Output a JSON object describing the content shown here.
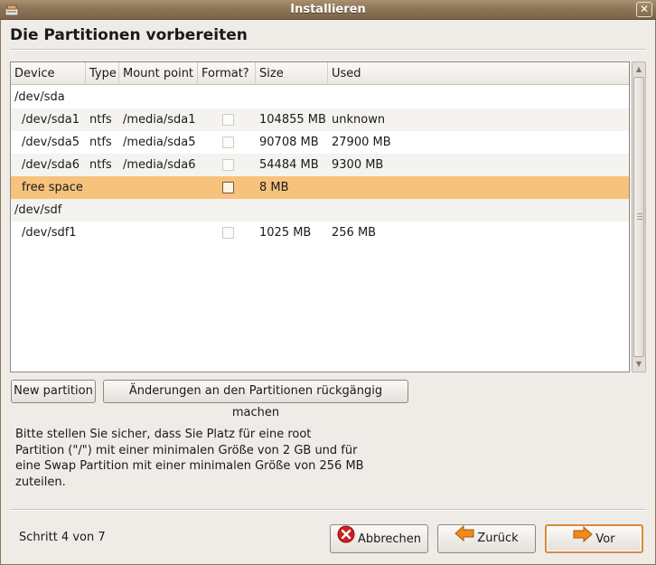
{
  "window": {
    "title": "Installieren"
  },
  "page": {
    "title": "Die Partitionen vorbereiten"
  },
  "table": {
    "headers": [
      "Device",
      "Type",
      "Mount point",
      "Format?",
      "Size",
      "Used"
    ],
    "rows": [
      {
        "device": "/dev/sda",
        "type": "",
        "mount": "",
        "format": null,
        "size": "",
        "used": ""
      },
      {
        "device": "/dev/sda1",
        "type": "ntfs",
        "mount": "/media/sda1",
        "format": false,
        "size": "104855 MB",
        "used": "unknown"
      },
      {
        "device": "/dev/sda5",
        "type": "ntfs",
        "mount": "/media/sda5",
        "format": false,
        "size": "90708 MB",
        "used": "27900 MB"
      },
      {
        "device": "/dev/sda6",
        "type": "ntfs",
        "mount": "/media/sda6",
        "format": false,
        "size": "54484 MB",
        "used": "9300 MB"
      },
      {
        "device": "free space",
        "type": "",
        "mount": "",
        "format": false,
        "size": "8 MB",
        "used": "",
        "selected": true
      },
      {
        "device": "/dev/sdf",
        "type": "",
        "mount": "",
        "format": null,
        "size": "",
        "used": ""
      },
      {
        "device": "/dev/sdf1",
        "type": "",
        "mount": "",
        "format": false,
        "size": "1025 MB",
        "used": "256 MB"
      }
    ]
  },
  "buttons": {
    "new_partition": "New partition",
    "undo_changes": "Änderungen an den Partitionen rückgängig machen",
    "cancel": "Abbrechen",
    "back": "Zurück",
    "forward": "Vor"
  },
  "info": {
    "lines": [
      "Bitte stellen Sie sicher, dass Sie Platz für eine root",
      "Partition (\"/\") mit einer minimalen Größe von 2 GB und für",
      "eine Swap Partition mit einer minimalen Größe von 256 MB",
      "zuteilen."
    ]
  },
  "footer": {
    "step": "Schritt 4 von 7"
  },
  "icons": {
    "app": "installer-icon",
    "close": "close-icon",
    "cancel": "cancel-icon",
    "back": "arrow-left-icon",
    "forward": "arrow-right-icon"
  },
  "colors": {
    "titlebar": "#8d7658",
    "selection": "#f6c27c",
    "cancel_icon": "#cc2020",
    "arrow_icon": "#f08a1c",
    "focus_border": "#d98a3a"
  }
}
